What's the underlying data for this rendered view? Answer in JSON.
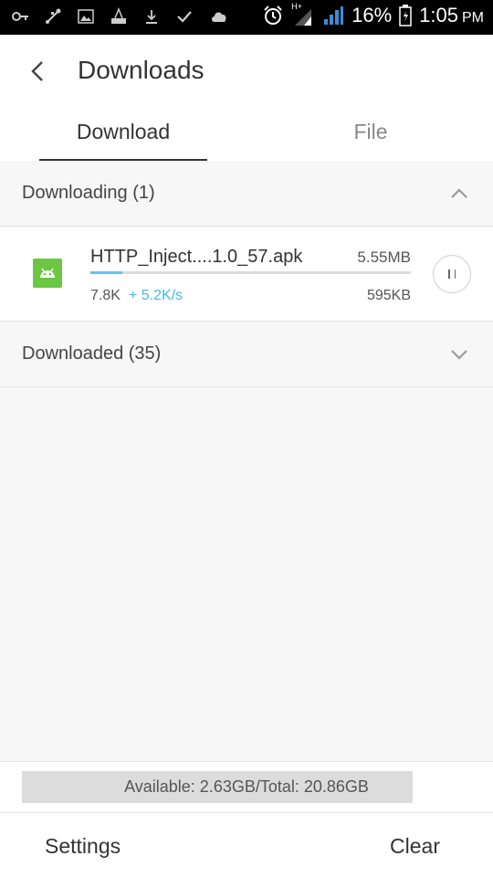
{
  "status_bar": {
    "battery": "16%",
    "time": "1:05",
    "ampm": "PM",
    "network": "H+",
    "icons": [
      "key-icon",
      "usb-icon",
      "image-icon",
      "cleaner-icon",
      "download-icon",
      "check-icon",
      "cloud-icon",
      "alarm-icon",
      "signal-icon",
      "signal-icon",
      "battery-icon"
    ]
  },
  "header": {
    "title": "Downloads",
    "back_icon": "arrow-left-icon"
  },
  "tabs": [
    {
      "label": "Download",
      "active": true
    },
    {
      "label": "File",
      "active": false
    }
  ],
  "sections": {
    "downloading": {
      "label": "Downloading (1)",
      "icon": "chevron-up-icon"
    },
    "downloaded": {
      "label": "Downloaded (35)",
      "icon": "chevron-down-icon"
    }
  },
  "download_item": {
    "name": "HTTP_Inject....1.0_57.apk",
    "size": "5.55MB",
    "downloaded": "7.8K",
    "speed": "+ 5.2K/s",
    "done": "595KB",
    "progress": 0.1,
    "icon": "android-icon",
    "action_icon": "pause-icon"
  },
  "storage": {
    "text": "Available: 2.63GB/Total: 20.86GB",
    "used_fraction": 0.87
  },
  "bottom_bar": {
    "settings_label": "Settings",
    "clear_label": "Clear"
  },
  "colors": {
    "accent_blue": "#46b8e8",
    "app_icon_green": "#6cc644",
    "status_bar_bg": "#000000"
  }
}
